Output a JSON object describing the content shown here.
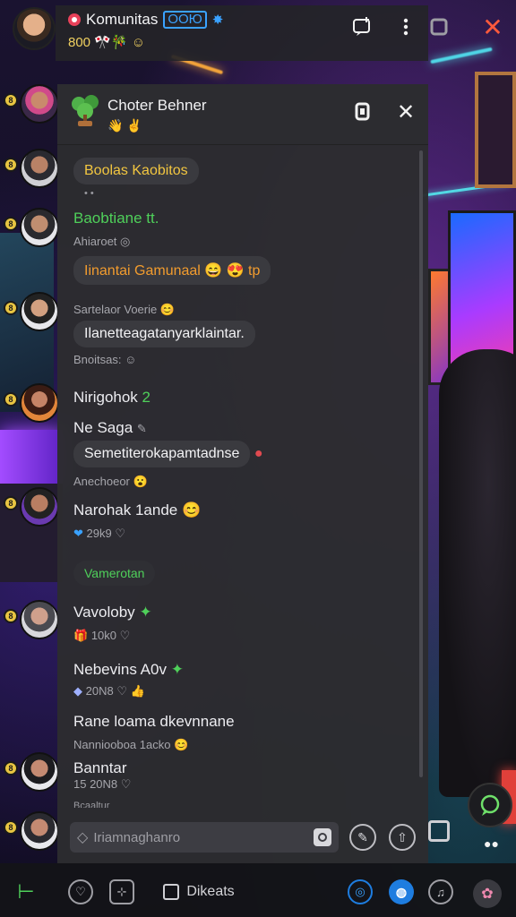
{
  "header": {
    "title": "Komunitas",
    "tag": "ООЮ",
    "subtitle": "800 🎌🎋"
  },
  "panel": {
    "title": "Choter Behner",
    "title_emoji": "👋 ✌",
    "composer_placeholder": "Iriamnaghanro"
  },
  "messages": [
    {
      "type": "pill",
      "text": "Boolas Kaobitos"
    },
    {
      "type": "tiny",
      "text": "• •"
    },
    {
      "type": "name",
      "text": "Baobtiane tt."
    },
    {
      "type": "meta",
      "text": "Ahiaroet"
    },
    {
      "type": "pill",
      "text": "Iinantai Gamunaal 😄 😍 tp"
    },
    {
      "type": "meta",
      "text": "Sartelaor Voerie"
    },
    {
      "type": "pill",
      "text": "Ilanetteagatanyarklaintar."
    },
    {
      "type": "meta",
      "text": "Bnoitsas:"
    },
    {
      "type": "name",
      "text": "Nirigohok"
    },
    {
      "type": "name",
      "text": "Ne Saga"
    },
    {
      "type": "pill",
      "text": "Semetiterokapamtadnse"
    },
    {
      "type": "meta",
      "text": "Anechoeor"
    },
    {
      "type": "name",
      "text": "Narohak 1ande"
    },
    {
      "type": "meta",
      "text": "29k9"
    },
    {
      "type": "meta",
      "text": "Vamerotan"
    },
    {
      "type": "name",
      "text": "Vavoloby"
    },
    {
      "type": "meta",
      "text": "10k0"
    },
    {
      "type": "name",
      "text": "Nebevins A0v"
    },
    {
      "type": "meta",
      "text": "20N8"
    },
    {
      "type": "name",
      "text": "Rane loama dkevnnane"
    },
    {
      "type": "meta",
      "text": "Nanniooboa 1acko"
    },
    {
      "type": "name",
      "text": "Banntar"
    },
    {
      "type": "meta",
      "text": "15 20N8"
    },
    {
      "type": "tiny",
      "text": "Bcaaltur"
    }
  ],
  "bottombar": {
    "label": "Dikeats"
  },
  "colors": {
    "accent_blue": "#1e7de0",
    "green_text": "#4fd05a",
    "yellow_text": "#f2c640",
    "close_red": "#ff5a3c",
    "panel_bg": "#2c2c30"
  },
  "icons": [
    "chat-plus-icon",
    "more-vertical-icon",
    "window-icon",
    "close-icon",
    "copy-icon",
    "gift-icon",
    "send-icon",
    "home-icon",
    "heart-icon",
    "grid-icon",
    "music-icon",
    "profile-icon"
  ]
}
